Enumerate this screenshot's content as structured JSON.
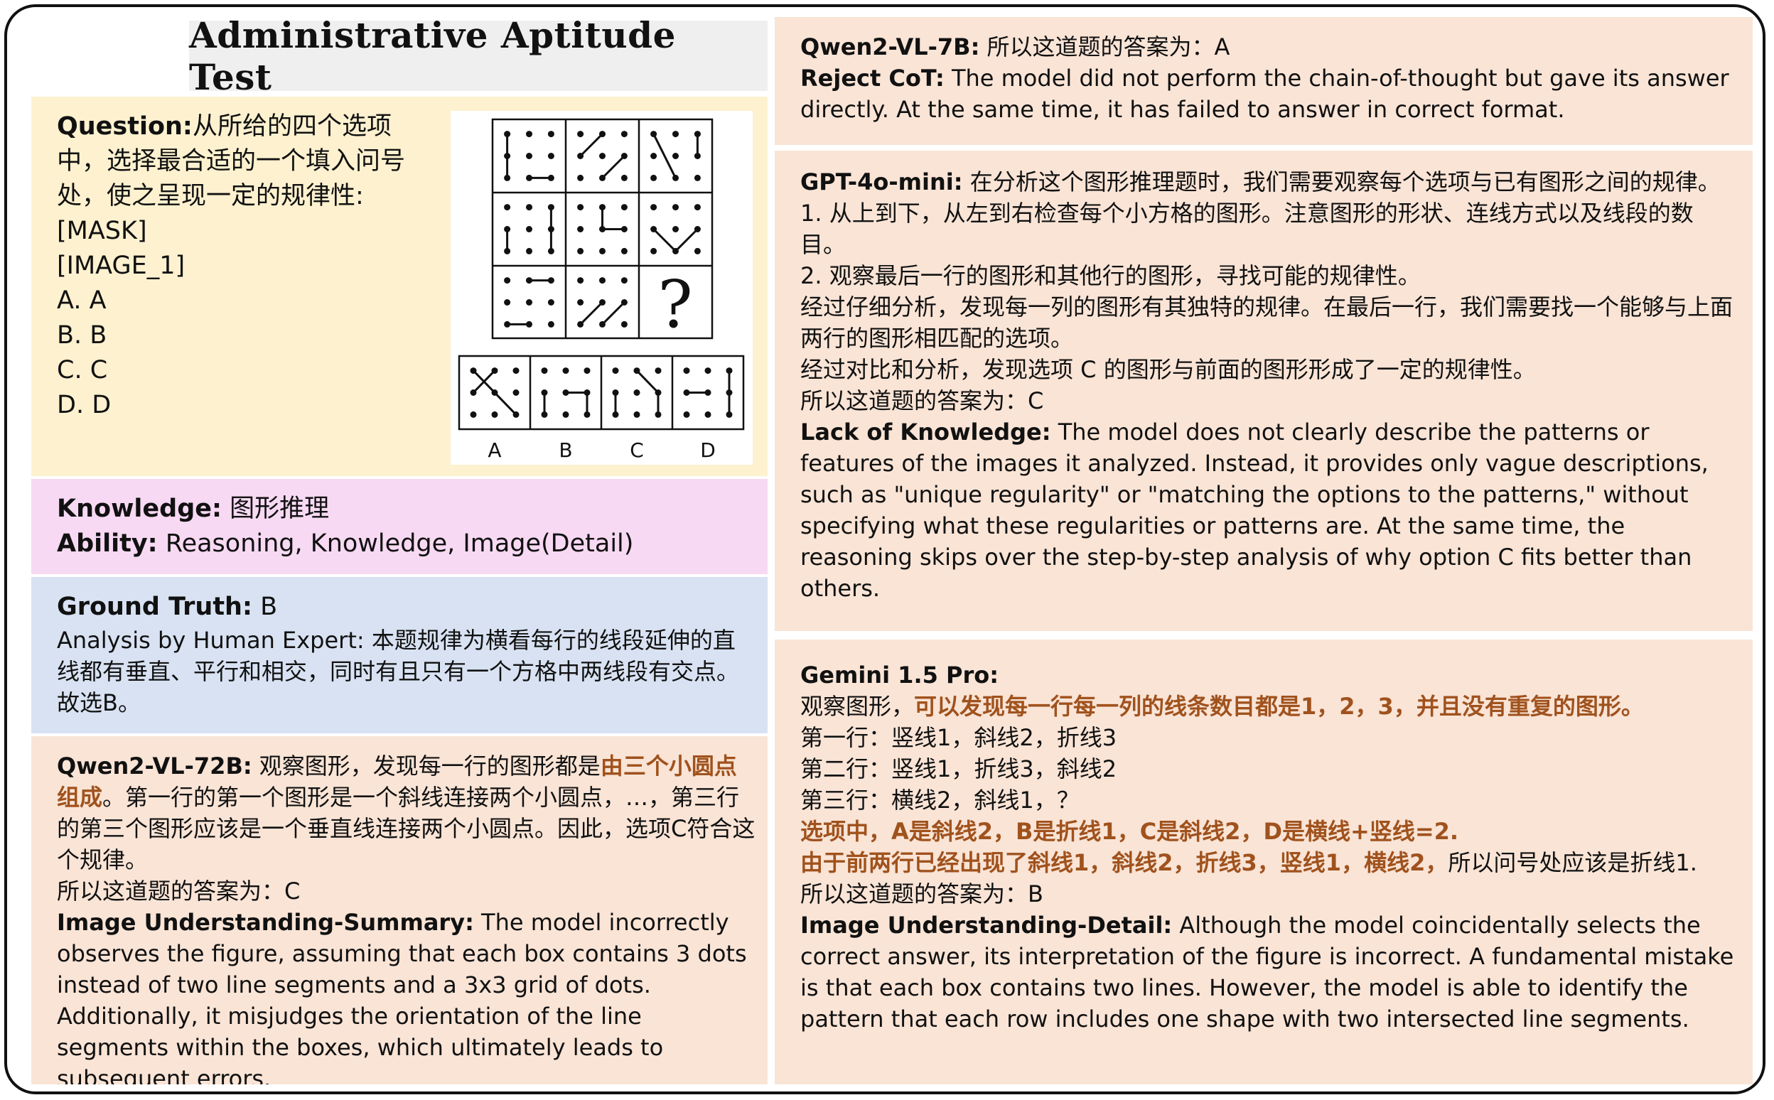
{
  "title": "Administrative Aptitude Test",
  "question": {
    "label": "Question:",
    "text": "从所给的四个选项中，选择最合适的一个填入问号处，使之呈现一定的规律性:[MASK]",
    "image_token": "[IMAGE_1]",
    "options": [
      "A. A",
      "B. B",
      "C. C",
      "D. D"
    ],
    "figure": {
      "question_mark": "?",
      "option_letters": [
        "A",
        "B",
        "C",
        "D"
      ]
    }
  },
  "knowledge": {
    "label": "Knowledge:",
    "value": "图形推理"
  },
  "ability": {
    "label": "Ability:",
    "value": "Reasoning, Knowledge, Image(Detail)"
  },
  "ground_truth": {
    "label": "Ground Truth:",
    "value": "B",
    "analysis": "Analysis by Human Expert: 本题规律为横看每行的线段延伸的直线都有垂直、平行和相交，同时有且只有一个方格中两线段有交点。故选B。"
  },
  "qwen72b": {
    "label": "Qwen2-VL-72B:",
    "text1": "观察图形，发现每一行的图形都是",
    "highlight": "由三个小圆点组成",
    "text2": "。第一行的第一个图形是一个斜线连接两个小圆点，…，第三行的第三个图形应该是一个垂直线连接两个小圆点。因此，选项C符合这个规律。",
    "answer": "所以这道题的答案为：C",
    "error_label": "Image Understanding-Summary:",
    "error_text": "The model incorrectly observes the figure, assuming that each box contains 3 dots instead of two line segments and a 3x3 grid of dots. Additionally, it misjudges the orientation of the line segments within the boxes, which ultimately leads to subsequent errors."
  },
  "qwen7b": {
    "label": "Qwen2-VL-7B:",
    "answer": "所以这道题的答案为：A",
    "error_label": "Reject CoT:",
    "error_text": "The model did not perform the chain-of-thought but gave its answer directly. At the same time, it has failed to answer in correct format."
  },
  "gpt4omini": {
    "label": "GPT-4o-mini:",
    "intro": "在分析这个图形推理题时，我们需要观察每个选项与已有图形之间的规律。",
    "step1": "1. 从上到下，从左到右检查每个小方格的图形。注意图形的形状、连线方式以及线段的数目。",
    "step2": "2. 观察最后一行的图形和其他行的图形，寻找可能的规律性。",
    "para3": "经过仔细分析，发现每一列的图形有其独特的规律。在最后一行，我们需要找一个能够与上面两行的图形相匹配的选项。",
    "para4": "经过对比和分析，发现选项 C 的图形与前面的图形形成了一定的规律性。",
    "answer": "所以这道题的答案为：C",
    "error_label": "Lack of Knowledge:",
    "error_text": "The model does not clearly describe the patterns or features of the images it analyzed. Instead, it provides only vague descriptions, such as \"unique regularity\" or \"matching the options to the patterns,\" without specifying what these regularities or patterns are. At the same time, the reasoning skips over the step-by-step analysis of why option C fits better than others."
  },
  "gemini": {
    "label": "Gemini 1.5 Pro:",
    "line1_plain": "观察图形，",
    "line1_hl": "可以发现每一行每一列的线条数目都是1，2，3，并且没有重复的图形。",
    "row1": "第一行：竖线1，斜线2，折线3",
    "row2": "第二行：竖线1，折线3，斜线2",
    "row3": "第三行：横线2，斜线1，？",
    "options_hl": "选项中，A是斜线2，B是折线1，C是斜线2，D是横线+竖线=2.",
    "reason_hl": "由于前两行已经出现了斜线1，斜线2，折线3，竖线1，横线2，",
    "reason_plain": "所以问号处应该是折线1.",
    "answer": "所以这道题的答案为：B",
    "error_label": "Image Understanding-Detail:",
    "error_text": "Although the model coincidentally selects the correct answer, its interpretation of the figure is incorrect. A fundamental mistake is that each box contains two lines. However, the model is able to identify the pattern that each row includes one shape with two intersected line segments."
  },
  "colors": {
    "peach": "#f9e4d6",
    "cream": "#fdf1cf",
    "pink": "#f7d9f3",
    "blue": "#d8e2f2",
    "highlight": "#a0521d"
  }
}
